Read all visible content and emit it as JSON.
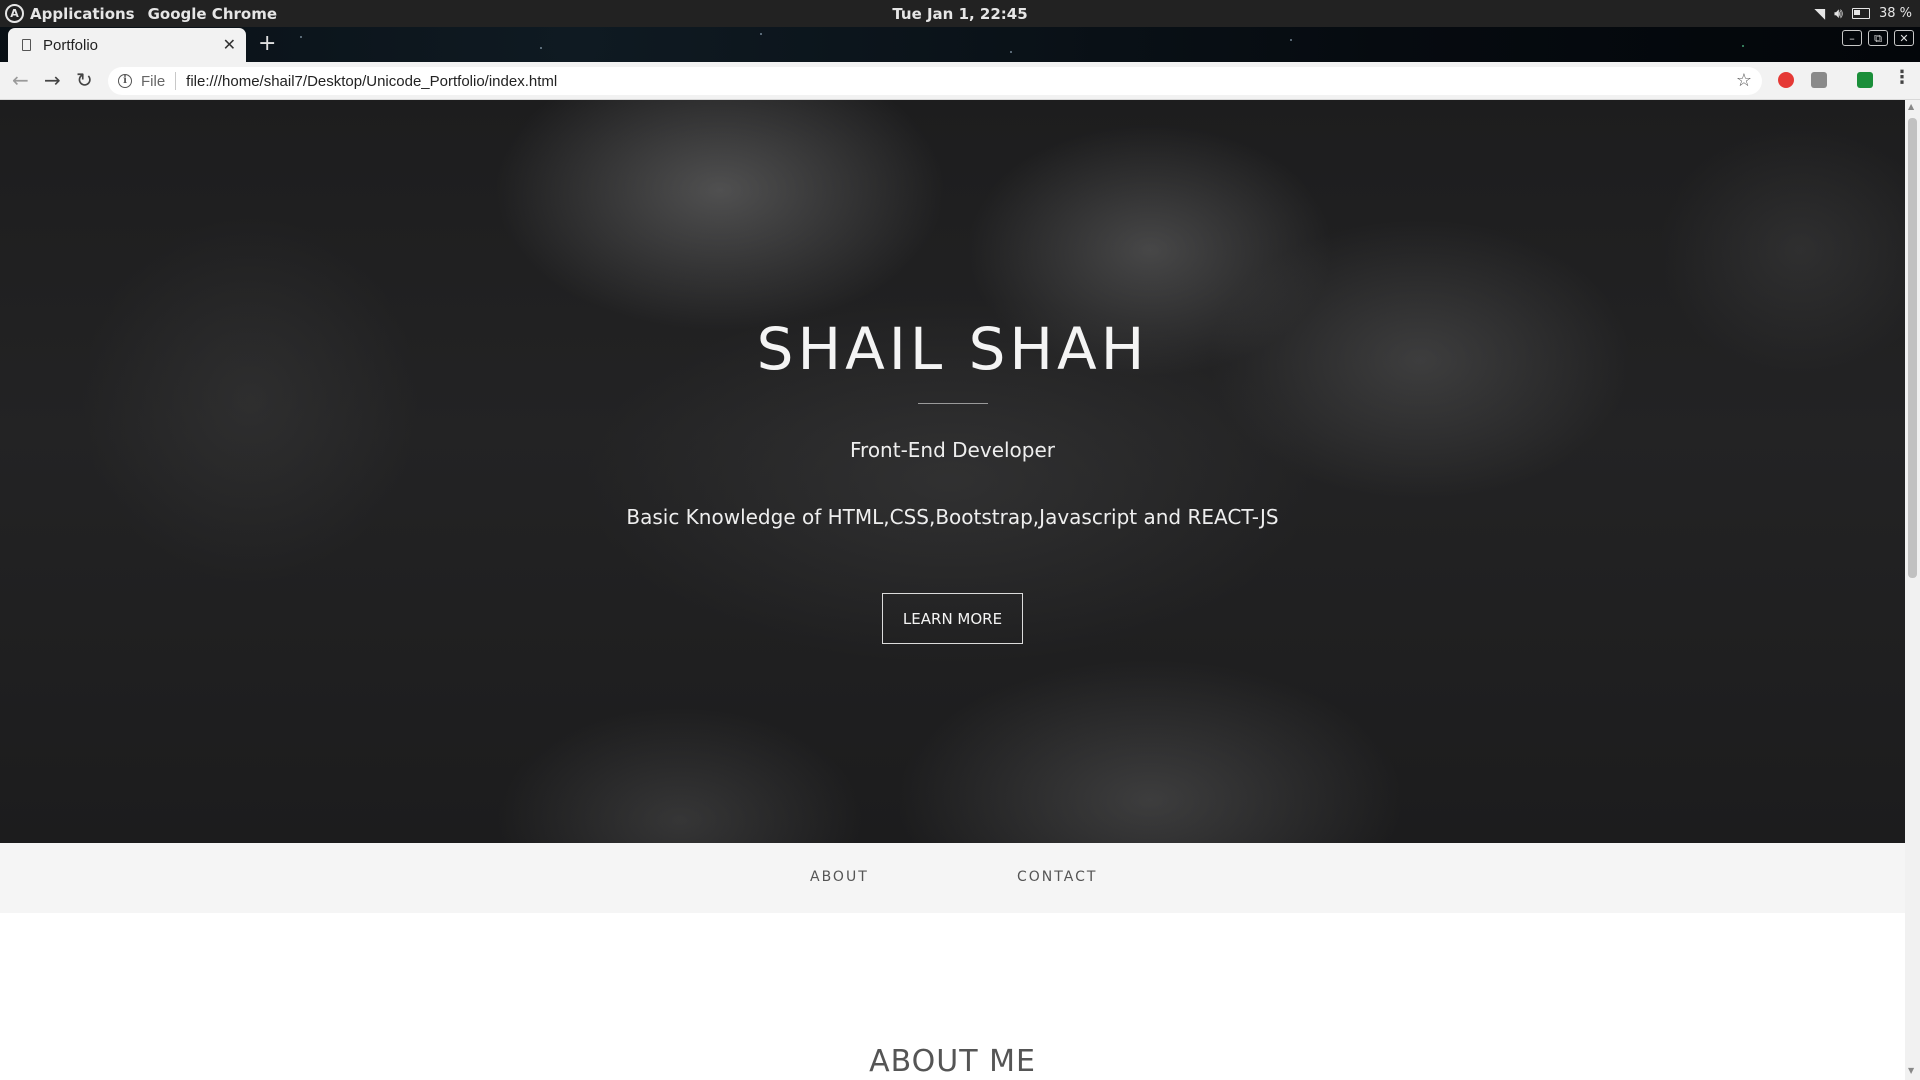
{
  "os_panel": {
    "applications_label": "Applications",
    "active_app": "Google Chrome",
    "clock": "Tue Jan  1, 22:45",
    "battery_percent": "38 %"
  },
  "browser": {
    "tab_title": "Portfolio",
    "scheme_label": "File",
    "url": "file:///home/shail7/Desktop/Unicode_Portfolio/index.html"
  },
  "page": {
    "hero": {
      "name": "SHAIL SHAH",
      "role": "Front-End Developer",
      "skills": "Basic Knowledge of HTML,CSS,Bootstrap,Javascript and REACT-JS",
      "button_label": "LEARN MORE"
    },
    "nav": {
      "about_label": "ABOUT",
      "contact_label": "CONTACT"
    },
    "about": {
      "heading": "ABOUT ME"
    }
  },
  "colors": {
    "hero_text": "#f4f4f4",
    "navbar_bg": "#f5f5f5",
    "nav_text": "#555555"
  },
  "icons": [
    "app-logo-icon",
    "wifi-icon",
    "volume-icon",
    "battery-icon",
    "page-icon",
    "close-icon",
    "new-tab-icon",
    "back-icon",
    "forward-icon",
    "reload-icon",
    "info-icon",
    "bookmark-star-icon",
    "menu-icon"
  ]
}
